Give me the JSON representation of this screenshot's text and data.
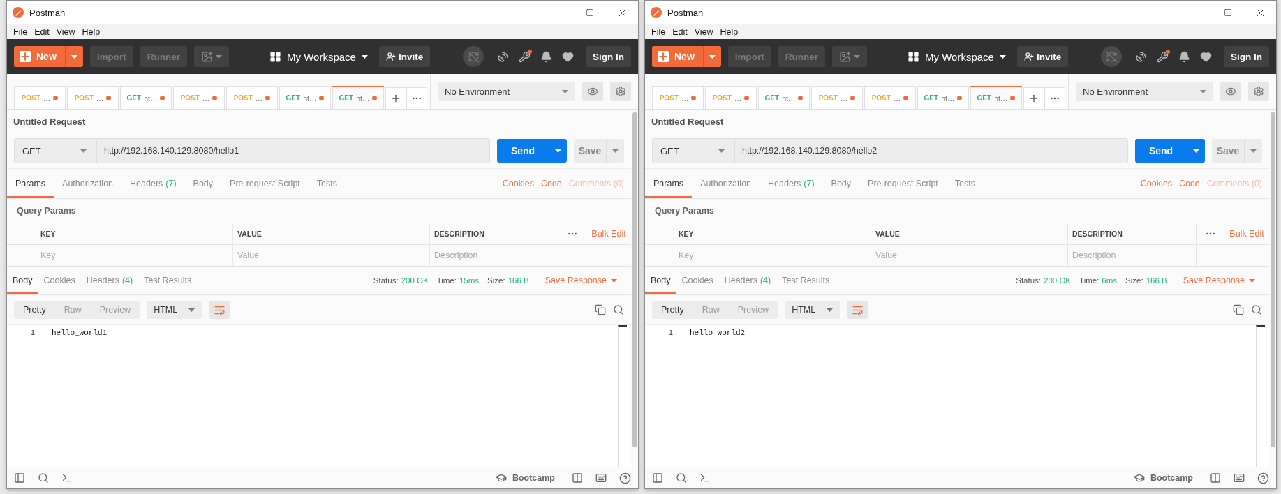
{
  "windows": [
    {
      "title": "Postman",
      "menu": [
        "File",
        "Edit",
        "View",
        "Help"
      ],
      "toolbar": {
        "new": "New",
        "import": "Import",
        "runner": "Runner",
        "workspace": "My Workspace",
        "invite": "Invite",
        "sign_in": "Sign In"
      },
      "tabs": [
        {
          "method": "POST",
          "label": "…",
          "color": "#f5a623",
          "selected": false,
          "unsaved": true
        },
        {
          "method": "POST",
          "label": "…",
          "color": "#f5a623",
          "selected": false,
          "unsaved": true
        },
        {
          "method": "GET",
          "label": "ht…",
          "color": "#26b47f",
          "selected": false,
          "unsaved": true
        },
        {
          "method": "POST",
          "label": "…",
          "color": "#f5a623",
          "selected": false,
          "unsaved": true
        },
        {
          "method": "POST",
          "label": "…",
          "color": "#f5a623",
          "selected": false,
          "unsaved": true
        },
        {
          "method": "GET",
          "label": "ht…",
          "color": "#26b47f",
          "selected": false,
          "unsaved": true
        },
        {
          "method": "GET",
          "label": "ht…",
          "color": "#26b47f",
          "selected": true,
          "unsaved": true
        }
      ],
      "environment": "No Environment",
      "request": {
        "name": "Untitled Request",
        "method": "GET",
        "url": "http://192.168.140.129:8080/hello1",
        "send": "Send",
        "save": "Save"
      },
      "request_tabs": [
        {
          "label": "Params",
          "selected": true
        },
        {
          "label": "Authorization",
          "selected": false
        },
        {
          "label": "Headers",
          "count": "(7)",
          "selected": false
        },
        {
          "label": "Body",
          "selected": false
        },
        {
          "label": "Pre-request Script",
          "selected": false
        },
        {
          "label": "Tests",
          "selected": false
        }
      ],
      "request_links": [
        {
          "label": "Cookies",
          "disabled": false
        },
        {
          "label": "Code",
          "disabled": false
        },
        {
          "label": "Comments (0)",
          "disabled": true
        }
      ],
      "query_params": {
        "title": "Query Params",
        "columns": [
          "KEY",
          "VALUE",
          "DESCRIPTION"
        ],
        "bulk_edit": "Bulk Edit",
        "placeholders": [
          "Key",
          "Value",
          "Description"
        ]
      },
      "response_tabs": [
        {
          "label": "Body",
          "selected": true
        },
        {
          "label": "Cookies",
          "selected": false
        },
        {
          "label": "Headers",
          "count": "(4)",
          "selected": false
        },
        {
          "label": "Test Results",
          "selected": false
        }
      ],
      "status": [
        {
          "label": "Status:",
          "value": "200 OK"
        },
        {
          "label": "Time:",
          "value": "15ms"
        },
        {
          "label": "Size:",
          "value": "166 B"
        }
      ],
      "save_response": "Save Response",
      "view_modes": [
        {
          "label": "Pretty",
          "selected": true
        },
        {
          "label": "Raw",
          "selected": false
        },
        {
          "label": "Preview",
          "selected": false
        }
      ],
      "format": "HTML",
      "lines": [
        {
          "number": "1",
          "text": "hello_world1"
        }
      ],
      "footer": {
        "bootcamp": "Bootcamp"
      }
    },
    {
      "title": "Postman",
      "menu": [
        "File",
        "Edit",
        "View",
        "Help"
      ],
      "toolbar": {
        "new": "New",
        "import": "Import",
        "runner": "Runner",
        "workspace": "My Workspace",
        "invite": "Invite",
        "sign_in": "Sign In"
      },
      "tabs": [
        {
          "method": "POST",
          "label": "…",
          "color": "#f5a623",
          "selected": false,
          "unsaved": true
        },
        {
          "method": "POST",
          "label": "…",
          "color": "#f5a623",
          "selected": false,
          "unsaved": true
        },
        {
          "method": "GET",
          "label": "ht…",
          "color": "#26b47f",
          "selected": false,
          "unsaved": true
        },
        {
          "method": "POST",
          "label": "…",
          "color": "#f5a623",
          "selected": false,
          "unsaved": true
        },
        {
          "method": "POST",
          "label": "…",
          "color": "#f5a623",
          "selected": false,
          "unsaved": true
        },
        {
          "method": "GET",
          "label": "ht…",
          "color": "#26b47f",
          "selected": false,
          "unsaved": true
        },
        {
          "method": "GET",
          "label": "ht…",
          "color": "#26b47f",
          "selected": true,
          "unsaved": true
        }
      ],
      "environment": "No Environment",
      "request": {
        "name": "Untitled Request",
        "method": "GET",
        "url": "http://192.168.140.129:8080/hello2",
        "send": "Send",
        "save": "Save"
      },
      "request_tabs": [
        {
          "label": "Params",
          "selected": true
        },
        {
          "label": "Authorization",
          "selected": false
        },
        {
          "label": "Headers",
          "count": "(7)",
          "selected": false
        },
        {
          "label": "Body",
          "selected": false
        },
        {
          "label": "Pre-request Script",
          "selected": false
        },
        {
          "label": "Tests",
          "selected": false
        }
      ],
      "request_links": [
        {
          "label": "Cookies",
          "disabled": false
        },
        {
          "label": "Code",
          "disabled": false
        },
        {
          "label": "Comments (0)",
          "disabled": true
        }
      ],
      "query_params": {
        "title": "Query Params",
        "columns": [
          "KEY",
          "VALUE",
          "DESCRIPTION"
        ],
        "bulk_edit": "Bulk Edit",
        "placeholders": [
          "Key",
          "Value",
          "Description"
        ]
      },
      "response_tabs": [
        {
          "label": "Body",
          "selected": true
        },
        {
          "label": "Cookies",
          "selected": false
        },
        {
          "label": "Headers",
          "count": "(4)",
          "selected": false
        },
        {
          "label": "Test Results",
          "selected": false
        }
      ],
      "status": [
        {
          "label": "Status:",
          "value": "200 OK"
        },
        {
          "label": "Time:",
          "value": "6ms"
        },
        {
          "label": "Size:",
          "value": "166 B"
        }
      ],
      "save_response": "Save Response",
      "view_modes": [
        {
          "label": "Pretty",
          "selected": true
        },
        {
          "label": "Raw",
          "selected": false
        },
        {
          "label": "Preview",
          "selected": false
        }
      ],
      "format": "HTML",
      "lines": [
        {
          "number": "1",
          "text": "hello world2"
        }
      ],
      "footer": {
        "bootcamp": "Bootcamp"
      }
    }
  ]
}
